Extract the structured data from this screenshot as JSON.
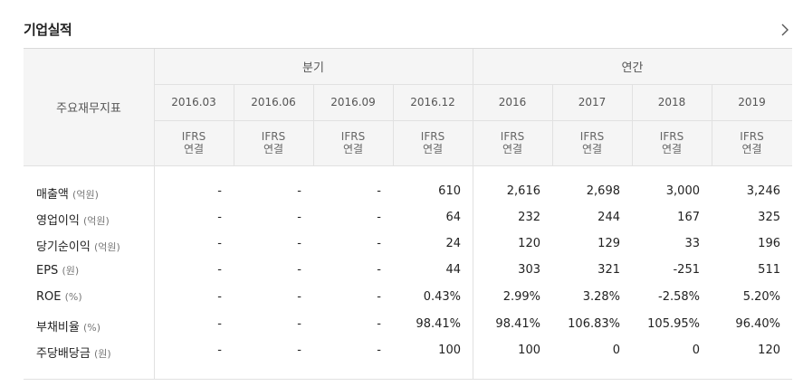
{
  "section": {
    "title": "기업실적"
  },
  "table": {
    "corner_label": "주요재무지표",
    "groups": [
      {
        "label": "분기"
      },
      {
        "label": "연간"
      }
    ],
    "columns": [
      {
        "period": "2016.03",
        "basis1": "IFRS",
        "basis2": "연결"
      },
      {
        "period": "2016.06",
        "basis1": "IFRS",
        "basis2": "연결"
      },
      {
        "period": "2016.09",
        "basis1": "IFRS",
        "basis2": "연결"
      },
      {
        "period": "2016.12",
        "basis1": "IFRS",
        "basis2": "연결"
      },
      {
        "period": "2016",
        "basis1": "IFRS",
        "basis2": "연결"
      },
      {
        "period": "2017",
        "basis1": "IFRS",
        "basis2": "연결"
      },
      {
        "period": "2018",
        "basis1": "IFRS",
        "basis2": "연결"
      },
      {
        "period": "2019",
        "basis1": "IFRS",
        "basis2": "연결"
      }
    ],
    "rows": [
      {
        "label": "매출액",
        "unit": "(억원)",
        "values": [
          "-",
          "-",
          "-",
          "610",
          "2,616",
          "2,698",
          "3,000",
          "3,246"
        ]
      },
      {
        "label": "영업이익",
        "unit": "(억원)",
        "values": [
          "-",
          "-",
          "-",
          "64",
          "232",
          "244",
          "167",
          "325"
        ]
      },
      {
        "label": "당기순이익",
        "unit": "(억원)",
        "values": [
          "-",
          "-",
          "-",
          "24",
          "120",
          "129",
          "33",
          "196"
        ]
      },
      {
        "label": "EPS",
        "unit": "(원)",
        "values": [
          "-",
          "-",
          "-",
          "44",
          "303",
          "321",
          "-251",
          "511"
        ]
      },
      {
        "label": "ROE",
        "unit": "(%)",
        "values": [
          "-",
          "-",
          "-",
          "0.43%",
          "2.99%",
          "3.28%",
          "-2.58%",
          "5.20%"
        ]
      },
      {
        "label": "부채비율",
        "unit": "(%)",
        "values": [
          "-",
          "-",
          "-",
          "98.41%",
          "98.41%",
          "106.83%",
          "105.95%",
          "96.40%"
        ]
      },
      {
        "label": "주당배당금",
        "unit": "(원)",
        "values": [
          "-",
          "-",
          "-",
          "100",
          "100",
          "0",
          "0",
          "120"
        ]
      }
    ]
  }
}
